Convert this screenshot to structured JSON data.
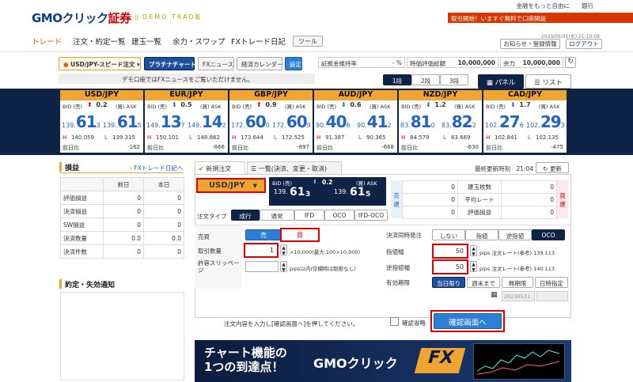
{
  "header": {
    "logo_main": "GMOクリック",
    "logo_accent": "証券",
    "demo_label": "DEMO TRADE",
    "top_links": "金融をもっと自由に",
    "top_links2": "銀行",
    "promo_badge1": "取引開始！",
    "promo_badge2": "",
    "promo_text": "取引開始！いますぐ無料で口座開設",
    "timestamp": "2023/05/31(水) 21:10:08",
    "notice_button": "お知らせ・登録情報",
    "logout_button": "ログアウト"
  },
  "nav": {
    "items": [
      "トレード",
      "注文・約定一覧",
      "建玉一覧",
      "余力・スワップ",
      "FXトレード日記"
    ],
    "tool_button": "ツール"
  },
  "toolbar": {
    "order_mode": "USD/JPY-スピード注文",
    "platinum_chart": "プラチナチャート",
    "fx_news": "FXニュース",
    "calendar": "経済カレンダー",
    "settings": "設定",
    "demo_notice": "デモ口座ではFXニュースをご覧いただけません。",
    "margin_rate_label": "証拠金維持率",
    "margin_rate_value": "- %",
    "valuation_label": "時価評価総額",
    "valuation_value": "10,000,000",
    "surplus_label": "余力",
    "surplus_value": "10,000,000",
    "tier1": "1段",
    "tier2": "2段",
    "tier3": "3段",
    "panel_tab": "パネル",
    "list_tab": "リスト"
  },
  "rates": [
    {
      "pair": "USD/JPY",
      "spread": "0.2",
      "bid_big": "139.",
      "bid_main": "61",
      "bid_pip": "3",
      "ask_big": "139.",
      "ask_main": "61",
      "ask_pip": "5",
      "high": "140.059",
      "low": "139.315",
      "change": "-162",
      "dir": "up"
    },
    {
      "pair": "EUR/JPY",
      "spread": "0.5",
      "bid_big": "149.",
      "bid_main": "13",
      "bid_pip": "7",
      "ask_big": "149.",
      "ask_main": "14",
      "ask_pip": "2",
      "high": "150.101",
      "low": "148.862",
      "change": "-866",
      "dir": "down"
    },
    {
      "pair": "GBP/JPY",
      "spread": "0.9",
      "bid_big": "172.",
      "bid_main": "60",
      "bid_pip": "0",
      "ask_big": "172.",
      "ask_main": "60",
      "ask_pip": "9",
      "high": "173.644",
      "low": "172.525",
      "change": "-897",
      "dir": "up"
    },
    {
      "pair": "AUD/JPY",
      "spread": "0.6",
      "bid_big": "90.",
      "bid_main": "40",
      "bid_pip": "6",
      "ask_big": "90.",
      "ask_main": "41",
      "ask_pip": "2",
      "high": "91.387",
      "low": "90.365",
      "change": "-668",
      "dir": "down"
    },
    {
      "pair": "NZD/JPY",
      "spread": "1.2",
      "bid_big": "83.",
      "bid_main": "81",
      "bid_pip": "0",
      "ask_big": "83.",
      "ask_main": "82",
      "ask_pip": "2",
      "high": "84.579",
      "low": "83.669",
      "change": "-630",
      "dir": "down"
    },
    {
      "pair": "CAD/JPY",
      "spread": "1.7",
      "bid_big": "102.",
      "bid_main": "27",
      "bid_pip": "6",
      "ask_big": "102.",
      "ask_main": "29",
      "ask_pip": "3",
      "high": "102.841",
      "low": "102.135",
      "change": "-475",
      "dir": "down"
    }
  ],
  "rate_labels": {
    "bid": "BID (売)",
    "ask": "(買) ASK",
    "high": "H",
    "low": "L",
    "prev": "前日比"
  },
  "pl": {
    "title": "損益",
    "diary_link": "FXトレード日記へ",
    "col_prev": "前日",
    "col_today": "本日",
    "rows": [
      {
        "label": "評価損益",
        "prev": "0",
        "today": "0"
      },
      {
        "label": "決済損益",
        "prev": "0",
        "today": "0"
      },
      {
        "label": "SW損益",
        "prev": "0",
        "today": "0"
      },
      {
        "label": "決済数量",
        "prev": "0.0",
        "today": "0.0"
      },
      {
        "label": "決済件数",
        "prev": "0",
        "today": "0"
      }
    ],
    "notify_title": "約定・失効通知"
  },
  "order": {
    "tab_new": "新規注文",
    "tab_list": "一覧(決済、変更・取消)",
    "last_update_label": "最終更新時刻",
    "last_update": "21:04",
    "update_button": "更新",
    "pair": "USD/JPY",
    "bid_label": "BID (売)",
    "ask_label": "(買) ASK",
    "spread": "0.2",
    "bid_big": "139.",
    "bid_main": "61",
    "bid_pip": "3",
    "ask_big": "139.",
    "ask_main": "61",
    "ask_pip": "5",
    "pos_sell": "売建",
    "pos_buy": "買建",
    "pos_rows": [
      {
        "sell": "0",
        "label": "建玉枚数",
        "buy": "0"
      },
      {
        "sell": "0",
        "label": "平均レート",
        "buy": "0"
      },
      {
        "sell": "0",
        "label": "評価損益",
        "buy": "0"
      }
    ],
    "order_type_label": "注文タイプ",
    "order_types": [
      "成行",
      "通常",
      "IFD",
      "OCO",
      "IFD-OCO"
    ],
    "side_label": "売買",
    "sell": "売",
    "buy": "買",
    "qty_label": "取引数量",
    "qty_value": "1",
    "qty_hint": "×10,000(最大:100×10,000)",
    "slip_label": "許容スリッページ",
    "slip_hint": "pips以内(空欄時は制限なし)",
    "settle_label": "決済同時発注",
    "settle_opts": [
      "しない",
      "指値",
      "逆指値",
      "OCO"
    ],
    "limit_label": "指値幅",
    "limit_value": "50",
    "limit_hint": "pips 注文レート(参考) 139.113",
    "stop_label": "逆指値幅",
    "stop_value": "50",
    "stop_hint": "pips 注文レート(参考) 140.113",
    "expiry_label": "有効期限",
    "expiry_opts": [
      "当日限り",
      "週末まで",
      "無期限",
      "日時指定"
    ],
    "expiry_date": "20230531",
    "instruction": "注文内容を入力し[確認画面へ]を押してください。",
    "skip_confirm": "確認省略",
    "confirm_button": "確認画面へ"
  },
  "banner": {
    "line1": "チャート機能の",
    "line2": "1つの到達点！",
    "brand": "GMOクリック",
    "fx": "FX"
  }
}
